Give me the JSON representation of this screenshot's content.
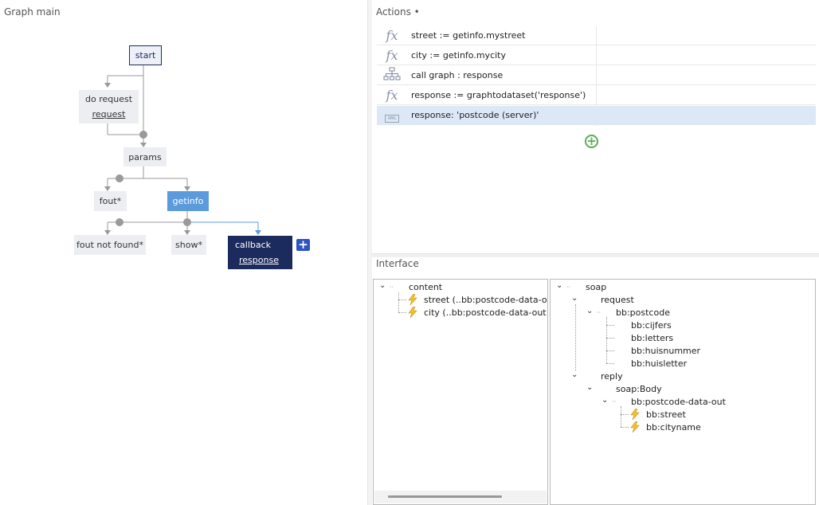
{
  "graph": {
    "title": "Graph main",
    "nodes": {
      "start": "start",
      "do_request": "do request",
      "do_request_link": "request",
      "params": "params",
      "fout": "fout*",
      "getinfo": "getinfo",
      "fout_not_found": "fout not found*",
      "show": "show*",
      "callback": "callback",
      "callback_link": "response"
    },
    "add_label": "+"
  },
  "actions": {
    "title": "Actions •",
    "items": [
      {
        "icon": "fx-icon",
        "text": "street := getinfo.mystreet"
      },
      {
        "icon": "fx-icon",
        "text": "city := getinfo.mycity"
      },
      {
        "icon": "sitemap-icon",
        "text": "call graph : response"
      },
      {
        "icon": "fx-icon",
        "text": "response := graphtodataset('response')"
      },
      {
        "icon": "xml-icon",
        "text": "response: 'postcode (server)'"
      }
    ],
    "xml_label": "XML",
    "fx_label": "fx",
    "add_label": "+"
  },
  "interface": {
    "title": "Interface",
    "left_tree": {
      "root": "content",
      "children": [
        "street (..bb:postcode-data-out",
        "city (..bb:postcode-data-out.b"
      ]
    },
    "right_tree": {
      "root": "soap",
      "request": "request",
      "postcode": "bb:postcode",
      "postcode_children": [
        "bb:cijfers",
        "bb:letters",
        "bb:huisnummer",
        "bb:huisletter"
      ],
      "reply": "reply",
      "body": "soap:Body",
      "data_out": "bb:postcode-data-out",
      "data_out_children": [
        "bb:street",
        "bb:cityname"
      ]
    },
    "chevron": "⌄",
    "dots": "··"
  },
  "colors": {
    "start_border": "#1e2a63",
    "getinfo": "#5b9bdc",
    "callback": "#1c2b5e",
    "add_button": "#2d54c4",
    "add_action": "#5aae52",
    "selected_row": "#dde8f6"
  }
}
